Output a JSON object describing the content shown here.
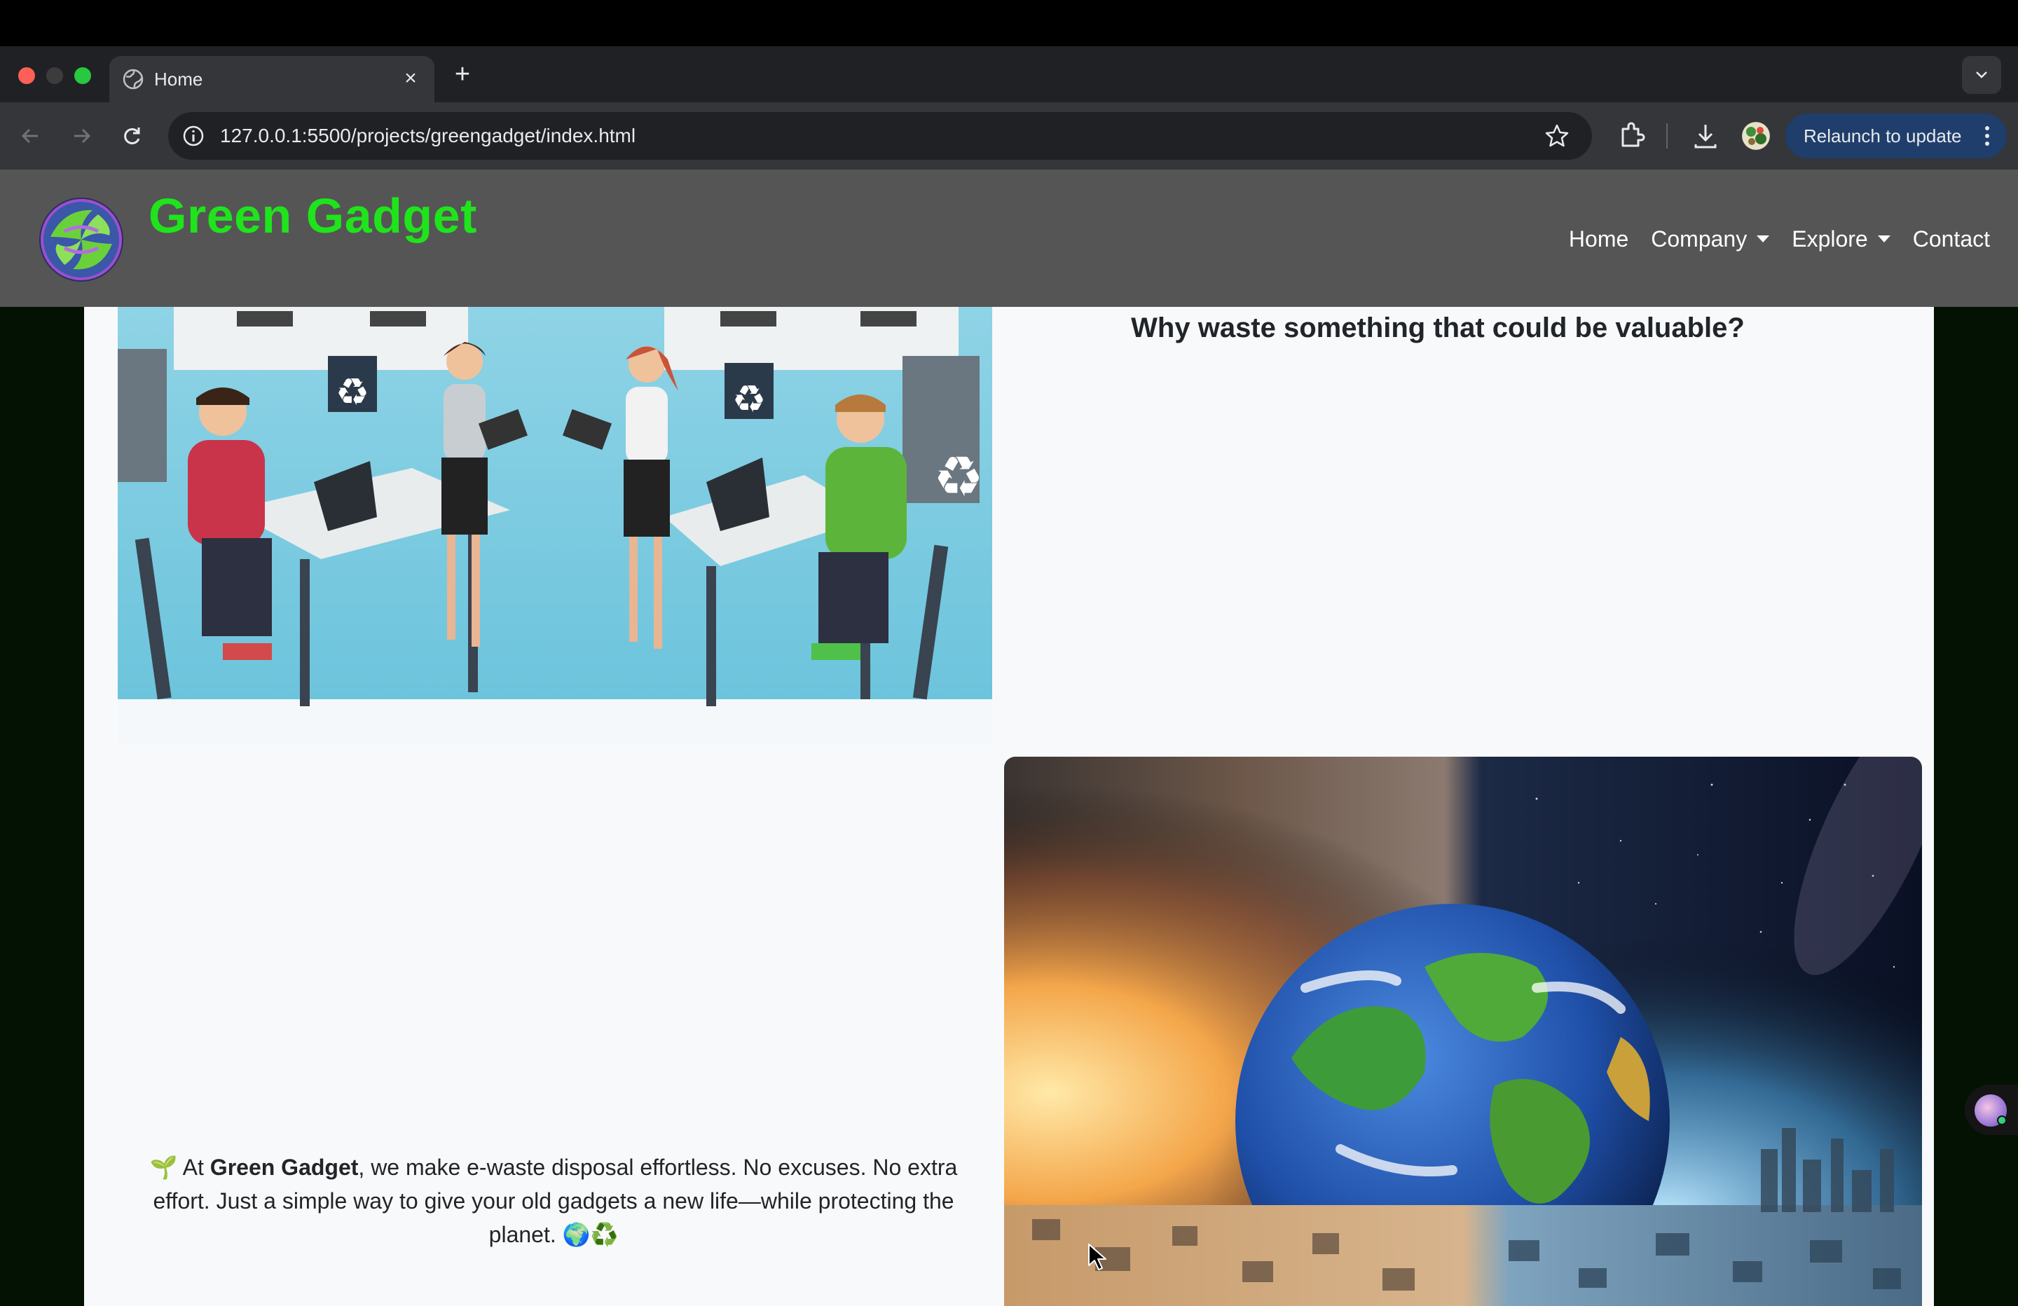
{
  "browser": {
    "tab_title": "Home",
    "url": "127.0.0.1:5500/projects/greengadget/index.html",
    "relaunch_label": "Relaunch to update"
  },
  "site": {
    "brand_name": "Green Gadget",
    "nav": {
      "home": "Home",
      "company": "Company",
      "explore": "Explore",
      "contact": "Contact"
    }
  },
  "main": {
    "heading": "Why waste something that could be valuable?",
    "tagline": {
      "icon": "🌱",
      "prefix": " At ",
      "brand": "Green Gadget",
      "rest": ", we make e-waste disposal effortless. No excuses. No extra effort. Just a simple way to give your old gadgets a new life—while protecting the planet. ",
      "suffix_icons": "🌍♻️"
    },
    "images": {
      "office": "office-recycling-illustration",
      "earth": "earth-over-ewaste-illustration"
    }
  },
  "colors": {
    "brand_green": "#1fe41c",
    "navbar_bg": "#555555",
    "page_bg": "#f8f9fa",
    "outer_bg": "#041204"
  }
}
